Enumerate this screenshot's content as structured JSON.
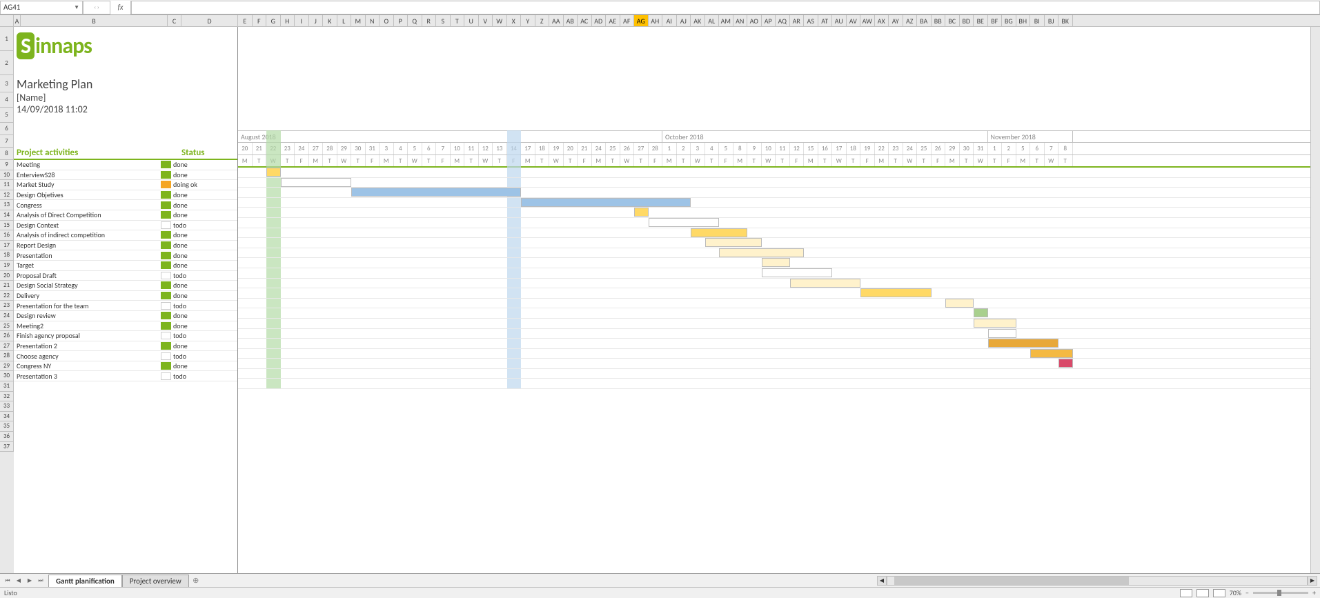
{
  "name_box": "AG41",
  "formula_value": "",
  "logo": "Sinnaps",
  "plan": {
    "title": "Marketing Plan",
    "name": "[Name]",
    "date": "14/09/2018 11:02"
  },
  "headers": {
    "activities": "Project activities",
    "status": "Status"
  },
  "months": [
    {
      "label": "August 2018",
      "span": 30
    },
    {
      "label": "October 2018",
      "span": 23
    },
    {
      "label": "November 2018",
      "span": 6
    }
  ],
  "days": [
    "20",
    "21",
    "22",
    "23",
    "24",
    "27",
    "28",
    "29",
    "30",
    "31",
    "3",
    "4",
    "5",
    "6",
    "7",
    "10",
    "11",
    "12",
    "13",
    "14",
    "17",
    "18",
    "19",
    "20",
    "21",
    "24",
    "25",
    "26",
    "27",
    "28",
    "1",
    "2",
    "3",
    "4",
    "5",
    "8",
    "9",
    "10",
    "11",
    "12",
    "15",
    "16",
    "17",
    "18",
    "19",
    "22",
    "23",
    "24",
    "25",
    "26",
    "29",
    "30",
    "31",
    "1",
    "2",
    "5",
    "6",
    "7",
    "8"
  ],
  "dows": [
    "M",
    "T",
    "W",
    "T",
    "F",
    "M",
    "T",
    "W",
    "T",
    "F",
    "M",
    "T",
    "W",
    "T",
    "F",
    "M",
    "T",
    "W",
    "T",
    "F",
    "M",
    "T",
    "W",
    "T",
    "F",
    "M",
    "T",
    "W",
    "T",
    "F",
    "M",
    "T",
    "W",
    "T",
    "F",
    "M",
    "T",
    "W",
    "T",
    "F",
    "M",
    "T",
    "W",
    "T",
    "F",
    "M",
    "T",
    "W",
    "T",
    "F",
    "M",
    "T",
    "W",
    "T",
    "F",
    "M",
    "T",
    "W",
    "T"
  ],
  "today_col_index": 2,
  "highlight_col_index": 19,
  "col_letters": [
    "A",
    "B",
    "C",
    "D",
    "E",
    "F",
    "G",
    "H",
    "I",
    "J",
    "K",
    "L",
    "M",
    "N",
    "O",
    "P",
    "Q",
    "R",
    "S",
    "T",
    "U",
    "V",
    "W",
    "X",
    "Y",
    "Z",
    "AA",
    "AB",
    "AC",
    "AD",
    "AE",
    "AF",
    "AG",
    "AH",
    "AI",
    "AJ",
    "AK",
    "AL",
    "AM",
    "AN",
    "AO",
    "AP",
    "AQ",
    "AR",
    "AS",
    "AT",
    "AU",
    "AV",
    "AW",
    "AX",
    "AY",
    "AZ",
    "BA",
    "BB",
    "BC",
    "BD",
    "BE",
    "BF",
    "BG",
    "BH",
    "BI",
    "BJ",
    "BK"
  ],
  "selected_col": "AG",
  "col_widths": {
    "A": 10,
    "B": 213,
    "C": 20,
    "D": 80
  },
  "activities": [
    {
      "name": "Meeting",
      "status": "done",
      "status_class": "done",
      "bar": {
        "start": 2,
        "len": 1,
        "color": "yellow"
      }
    },
    {
      "name": "EnterviewS28",
      "status": "done",
      "status_class": "done",
      "bar": {
        "start": 3,
        "len": 5,
        "color": "white"
      }
    },
    {
      "name": "Market Study",
      "status": "doing ok",
      "status_class": "doing",
      "bar": {
        "start": 8,
        "len": 12,
        "color": "blue"
      }
    },
    {
      "name": "Design Objetives",
      "status": "done",
      "status_class": "done",
      "bar": {
        "start": 20,
        "len": 12,
        "color": "blue"
      }
    },
    {
      "name": "Congress",
      "status": "done",
      "status_class": "done",
      "bar": {
        "start": 28,
        "len": 1,
        "color": "yellow"
      }
    },
    {
      "name": "Analysis of Direct Competition",
      "status": "done",
      "status_class": "done",
      "bar": {
        "start": 29,
        "len": 5,
        "color": "white"
      }
    },
    {
      "name": "Design Context",
      "status": "todo",
      "status_class": "todo",
      "bar": {
        "start": 32,
        "len": 4,
        "color": "yellow"
      }
    },
    {
      "name": "Analysis of indirect competition",
      "status": "done",
      "status_class": "done",
      "bar": {
        "start": 33,
        "len": 4,
        "color": "paleyellow"
      }
    },
    {
      "name": "Report Design",
      "status": "done",
      "status_class": "done",
      "bar": {
        "start": 34,
        "len": 6,
        "color": "paleyellow"
      }
    },
    {
      "name": "Presentation",
      "status": "done",
      "status_class": "done",
      "bar": {
        "start": 37,
        "len": 2,
        "color": "paleyellow"
      }
    },
    {
      "name": "Target",
      "status": "done",
      "status_class": "done",
      "bar": {
        "start": 37,
        "len": 5,
        "color": "white"
      }
    },
    {
      "name": "Proposal Draft",
      "status": "todo",
      "status_class": "todo",
      "bar": {
        "start": 39,
        "len": 5,
        "color": "paleyellow"
      }
    },
    {
      "name": "Design Social Strategy",
      "status": "done",
      "status_class": "done",
      "bar": {
        "start": 44,
        "len": 5,
        "color": "yellow"
      }
    },
    {
      "name": "Delivery",
      "status": "done",
      "status_class": "done",
      "bar": {
        "start": 50,
        "len": 2,
        "color": "paleyellow"
      }
    },
    {
      "name": "Presentation for the team",
      "status": "todo",
      "status_class": "todo",
      "bar": {
        "start": 52,
        "len": 1,
        "color": "green"
      }
    },
    {
      "name": "Design review",
      "status": "done",
      "status_class": "done",
      "bar": {
        "start": 52,
        "len": 3,
        "color": "paleyellow"
      }
    },
    {
      "name": "Meeting2",
      "status": "done",
      "status_class": "done",
      "bar": {
        "start": 53,
        "len": 2,
        "color": "white"
      }
    },
    {
      "name": "Finish agency proposal",
      "status": "todo",
      "status_class": "todo",
      "bar": {
        "start": 53,
        "len": 5,
        "color": "darkorange"
      }
    },
    {
      "name": "Presentation 2",
      "status": "done",
      "status_class": "done",
      "bar": {
        "start": 56,
        "len": 3,
        "color": "orange"
      }
    },
    {
      "name": "Choose agency",
      "status": "todo",
      "status_class": "todo",
      "bar": {
        "start": 58,
        "len": 1,
        "color": "red"
      }
    },
    {
      "name": "Congress NY",
      "status": "done",
      "status_class": "done",
      "bar": null
    },
    {
      "name": "Presentation 3",
      "status": "todo",
      "status_class": "todo",
      "bar": null
    }
  ],
  "tabs": {
    "active": "Gantt planification",
    "others": [
      "Project overview"
    ]
  },
  "status_bar": {
    "ready": "Listo",
    "zoom": "70%"
  },
  "chart_data": {
    "type": "gantt",
    "title": "Marketing Plan",
    "date_generated": "14/09/2018 11:02",
    "timeline_start": "2018-08-20",
    "timeline_end": "2018-11-08",
    "tasks": [
      {
        "name": "Meeting",
        "status": "done",
        "start_day_index": 2,
        "duration_days": 1
      },
      {
        "name": "EnterviewS28",
        "status": "done",
        "start_day_index": 3,
        "duration_days": 5
      },
      {
        "name": "Market Study",
        "status": "doing ok",
        "start_day_index": 8,
        "duration_days": 12
      },
      {
        "name": "Design Objetives",
        "status": "done",
        "start_day_index": 20,
        "duration_days": 12
      },
      {
        "name": "Congress",
        "status": "done",
        "start_day_index": 28,
        "duration_days": 1
      },
      {
        "name": "Analysis of Direct Competition",
        "status": "done",
        "start_day_index": 29,
        "duration_days": 5
      },
      {
        "name": "Design Context",
        "status": "todo",
        "start_day_index": 32,
        "duration_days": 4
      },
      {
        "name": "Analysis of indirect competition",
        "status": "done",
        "start_day_index": 33,
        "duration_days": 4
      },
      {
        "name": "Report Design",
        "status": "done",
        "start_day_index": 34,
        "duration_days": 6
      },
      {
        "name": "Presentation",
        "status": "done",
        "start_day_index": 37,
        "duration_days": 2
      },
      {
        "name": "Target",
        "status": "done",
        "start_day_index": 37,
        "duration_days": 5
      },
      {
        "name": "Proposal Draft",
        "status": "todo",
        "start_day_index": 39,
        "duration_days": 5
      },
      {
        "name": "Design Social Strategy",
        "status": "done",
        "start_day_index": 44,
        "duration_days": 5
      },
      {
        "name": "Delivery",
        "status": "done",
        "start_day_index": 50,
        "duration_days": 2
      },
      {
        "name": "Presentation for the team",
        "status": "todo",
        "start_day_index": 52,
        "duration_days": 1
      },
      {
        "name": "Design review",
        "status": "done",
        "start_day_index": 52,
        "duration_days": 3
      },
      {
        "name": "Meeting2",
        "status": "done",
        "start_day_index": 53,
        "duration_days": 2
      },
      {
        "name": "Finish agency proposal",
        "status": "todo",
        "start_day_index": 53,
        "duration_days": 5
      },
      {
        "name": "Presentation 2",
        "status": "done",
        "start_day_index": 56,
        "duration_days": 3
      },
      {
        "name": "Choose agency",
        "status": "todo",
        "start_day_index": 58,
        "duration_days": 1
      },
      {
        "name": "Congress NY",
        "status": "done"
      },
      {
        "name": "Presentation 3",
        "status": "todo"
      }
    ]
  }
}
